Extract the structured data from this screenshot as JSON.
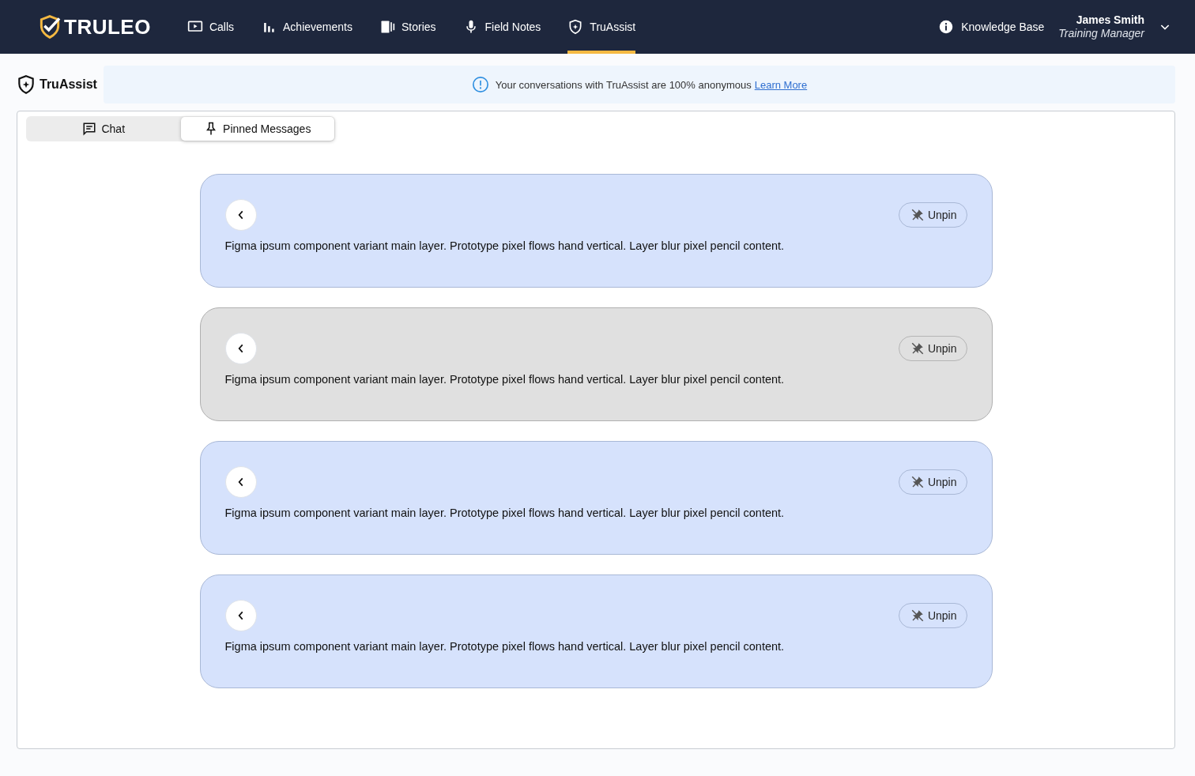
{
  "header": {
    "logo": "TRULEO",
    "nav": [
      {
        "kind": "calls",
        "label": "Calls",
        "selected": false
      },
      {
        "kind": "achievements",
        "label": "Achievements",
        "selected": false
      },
      {
        "kind": "stories",
        "label": "Stories",
        "selected": false
      },
      {
        "kind": "field_notes",
        "label": "Field Notes",
        "selected": false
      },
      {
        "kind": "truassist",
        "label": "TruAssist",
        "selected": true
      }
    ],
    "knowledge_base": "Knowledge Base",
    "user": {
      "name": "James Smith",
      "role": "Training Manager"
    }
  },
  "page_title": "TruAssist",
  "banner": {
    "text": "Your conversations with TruAssist are 100% anonymous",
    "link": "Learn More"
  },
  "tabs": [
    {
      "kind": "chat",
      "label": "Chat",
      "selected": false
    },
    {
      "kind": "pin",
      "label": "Pinned Messages",
      "selected": true
    }
  ],
  "messages": [
    {
      "text": "Figma ipsum component variant main layer. Prototype pixel flows hand vertical. Layer blur pixel pencil content.",
      "unpin": "Unpin",
      "selected": false
    },
    {
      "text": "Figma ipsum component variant main layer. Prototype pixel flows hand vertical. Layer blur pixel pencil content.",
      "unpin": "Unpin",
      "selected": true
    },
    {
      "text": "Figma ipsum component variant main layer. Prototype pixel flows hand vertical. Layer blur pixel pencil content.",
      "unpin": "Unpin",
      "selected": false
    },
    {
      "text": "Figma ipsum component variant main layer. Prototype pixel flows hand vertical. Layer blur pixel pencil content.",
      "unpin": "Unpin",
      "selected": false
    }
  ]
}
